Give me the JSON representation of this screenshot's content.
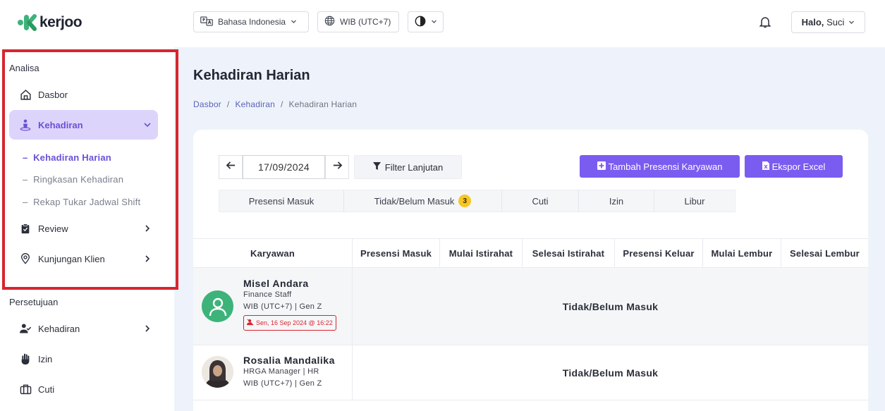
{
  "app": {
    "logo_text": "kerjoo"
  },
  "sidebar": {
    "section_analisa": "Analisa",
    "dasbor": "Dasbor",
    "kehadiran": "Kehadiran",
    "sub_kehadiran_harian": "Kehadiran Harian",
    "sub_ringkasan": "Ringkasan Kehadiran",
    "sub_rekap": "Rekap Tukar Jadwal Shift",
    "review": "Review",
    "kunjungan": "Kunjungan Klien",
    "section_persetujuan": "Persetujuan",
    "persetujuan_kehadiran": "Kehadiran",
    "izin": "Izin",
    "cuti": "Cuti"
  },
  "topbar": {
    "language": "Bahasa Indonesia",
    "timezone": "WIB (UTC+7)",
    "greeting_bold": "Halo,",
    "greeting_name": "Suci"
  },
  "page": {
    "title": "Kehadiran Harian",
    "breadcrumb": [
      "Dasbor",
      "Kehadiran",
      "Kehadiran Harian"
    ],
    "breadcrumb_sep": "/"
  },
  "toolbar": {
    "date": "17/09/2024",
    "filter_label": "Filter Lanjutan",
    "add_label": "Tambah Presensi Karyawan",
    "export_label": "Ekspor Excel"
  },
  "tabs": [
    {
      "label": "Presensi Masuk"
    },
    {
      "label": "Tidak/Belum Masuk",
      "badge": "3"
    },
    {
      "label": "Cuti"
    },
    {
      "label": "Izin"
    },
    {
      "label": "Libur"
    }
  ],
  "table": {
    "columns": [
      "Karyawan",
      "Presensi Masuk",
      "Mulai Istirahat",
      "Selesai Istirahat",
      "Presensi Keluar",
      "Mulai Lembur",
      "Selesai Lembur"
    ],
    "rows": [
      {
        "name": "Misel Andara",
        "role": "Finance Staff",
        "tz_group": "WIB (UTC+7) | Gen Z",
        "late_note": "Sen, 16 Sep 2024 @ 16:22",
        "status": "Tidak/Belum Masuk"
      },
      {
        "name": "Rosalia Mandalika",
        "role": "HRGA Manager | HR",
        "tz_group": "WIB (UTC+7) | Gen Z",
        "status": "Tidak/Belum Masuk"
      }
    ]
  },
  "colors": {
    "accent": "#7b5cf0",
    "active_bg": "#ddd4fb",
    "highlight": "#d7262e",
    "badge": "#f6c625",
    "avatar_green": "#3db37a"
  }
}
